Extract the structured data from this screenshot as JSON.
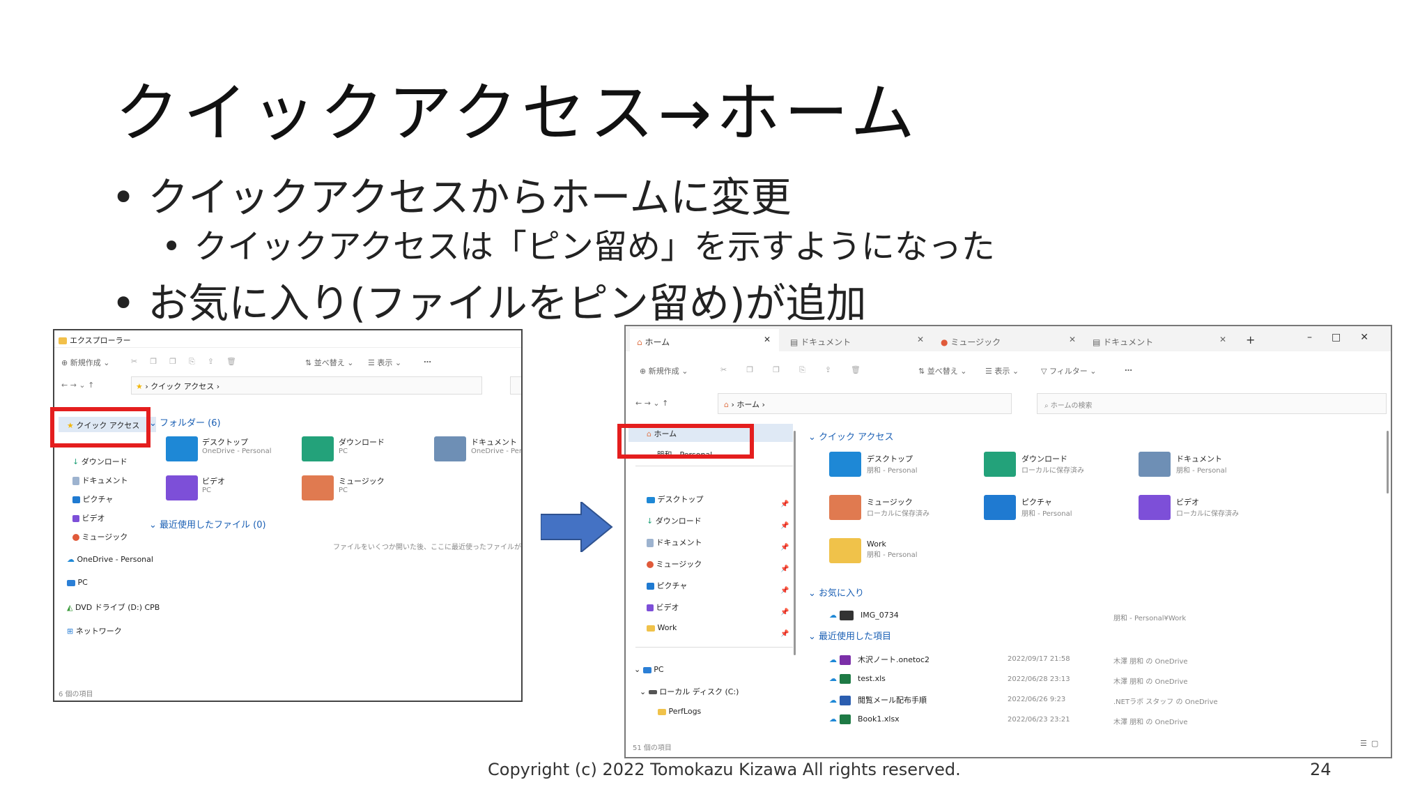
{
  "slide": {
    "title": "クイックアクセス→ホーム",
    "bullets": [
      "クイックアクセスからホームに変更",
      "クイックアクセスは「ピン留め」を示すようになった",
      "お気に入り(ファイルをピン留め)が追加"
    ],
    "bullet_char": "•",
    "footer": "Copyright (c) 2022 Tomokazu Kizawa All rights reserved.",
    "page_number": "24",
    "arrow_color": "#4472c4",
    "highlight_color": "#e41e1e"
  },
  "old_explorer": {
    "title": "エクスプローラー",
    "toolbar": {
      "new": "新規作成",
      "sort": "並べ替え",
      "view": "表示",
      "more": "…"
    },
    "address": "クイック アクセス",
    "nav": [
      "クイック アクセス",
      "ダウンロード",
      "ドキュメント",
      "ピクチャ",
      "ビデオ",
      "ミュージック",
      "OneDrive - Personal",
      "PC",
      "DVD ドライブ (D:) CPB",
      "ネットワーク"
    ],
    "folders_header": "フォルダー (6)",
    "folders": [
      {
        "name": "デスクトップ",
        "sub": "OneDrive - Personal",
        "color": "#1e88d6"
      },
      {
        "name": "ダウンロード",
        "sub": "PC",
        "color": "#23a27a"
      },
      {
        "name": "ドキュメント",
        "sub": "OneDrive - Person",
        "color": "#6e8fb5"
      },
      {
        "name": "ビデオ",
        "sub": "PC",
        "color": "#7d4fd8"
      },
      {
        "name": "ミュージック",
        "sub": "PC",
        "color": "#e07a50"
      }
    ],
    "recent_header": "最近使用したファイル (0)",
    "recent_empty": "ファイルをいくつか開いた後、ここに最近使ったファイルが表示されます。",
    "status": "6 個の項目"
  },
  "new_explorer": {
    "tabs": [
      "ホーム",
      "ドキュメント",
      "ミュージック",
      "ドキュメント"
    ],
    "toolbar": {
      "new": "新規作成",
      "sort": "並べ替え",
      "view": "表示",
      "filter": "フィルター",
      "more": "…"
    },
    "address": "ホーム",
    "search_placeholder": "ホームの検索",
    "nav_top": [
      "ホーム",
      "朋和 - Personal"
    ],
    "nav_pinned": [
      "デスクトップ",
      "ダウンロード",
      "ドキュメント",
      "ミュージック",
      "ピクチャ",
      "ビデオ",
      "Work"
    ],
    "nav_pc": [
      "PC",
      "ローカル ディスク (C:)",
      "PerfLogs"
    ],
    "quick_header": "クイック アクセス",
    "quick": [
      {
        "name": "デスクトップ",
        "sub": "朋和 - Personal",
        "color": "#1e88d6"
      },
      {
        "name": "ダウンロード",
        "sub": "ローカルに保存済み",
        "color": "#23a27a"
      },
      {
        "name": "ドキュメント",
        "sub": "朋和 - Personal",
        "color": "#6e8fb5"
      },
      {
        "name": "ミュージック",
        "sub": "ローカルに保存済み",
        "color": "#e07a50"
      },
      {
        "name": "ピクチャ",
        "sub": "朋和 - Personal",
        "color": "#1f7ad1"
      },
      {
        "name": "ビデオ",
        "sub": "ローカルに保存済み",
        "color": "#7d4fd8"
      },
      {
        "name": "Work",
        "sub": "朋和 - Personal",
        "color": "#f0c24a"
      }
    ],
    "fav_header": "お気に入り",
    "favorites": [
      {
        "name": "IMG_0734",
        "location": "朋和 - Personal¥Work"
      }
    ],
    "recent_header": "最近使用した項目",
    "recent": [
      {
        "name": "木沢ノート.onetoc2",
        "date": "2022/09/17 21:58",
        "location": "木澤 朋和 の OneDrive",
        "color": "#7b2fa8"
      },
      {
        "name": "test.xls",
        "date": "2022/06/28 23:13",
        "location": "木澤 朋和 の OneDrive",
        "color": "#1e7a45"
      },
      {
        "name": "閲覧メール配布手順",
        "date": "2022/06/26 9:23",
        "location": ".NETラボ スタッフ の OneDrive",
        "color": "#2b5eb0"
      },
      {
        "name": "Book1.xlsx",
        "date": "2022/06/23 23:21",
        "location": "木澤 朋和 の OneDrive",
        "color": "#1e7a45"
      }
    ],
    "status": "51 個の項目"
  }
}
